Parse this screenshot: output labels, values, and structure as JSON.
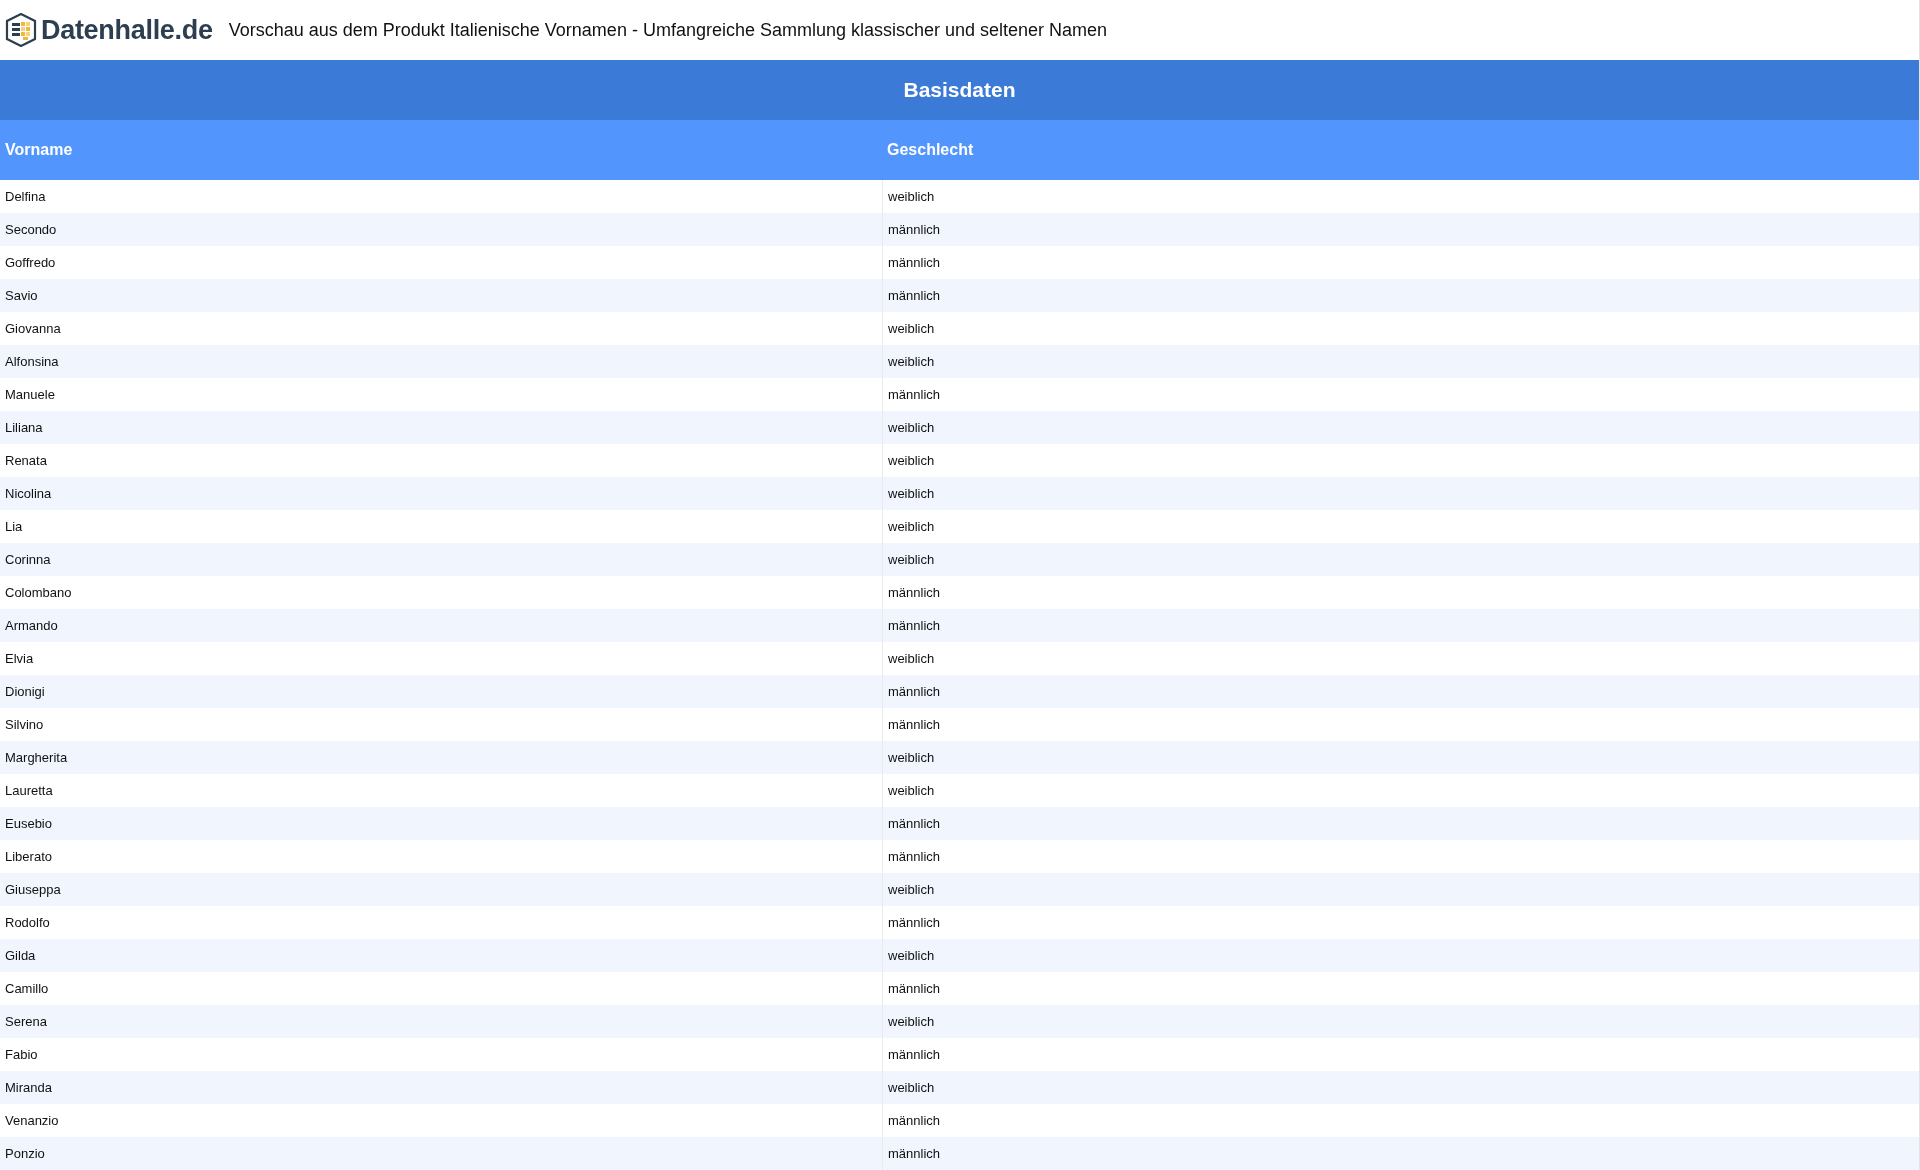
{
  "header": {
    "logo_text": "Datenhalle.de",
    "title": "Vorschau aus dem Produkt Italienische Vornamen - Umfangreiche Sammlung klassischer und seltener Namen"
  },
  "table": {
    "group_heading": "Basisdaten",
    "columns": [
      "Vorname",
      "Geschlecht"
    ],
    "rows": [
      [
        "Delfina",
        "weiblich"
      ],
      [
        "Secondo",
        "männlich"
      ],
      [
        "Goffredo",
        "männlich"
      ],
      [
        "Savio",
        "männlich"
      ],
      [
        "Giovanna",
        "weiblich"
      ],
      [
        "Alfonsina",
        "weiblich"
      ],
      [
        "Manuele",
        "männlich"
      ],
      [
        "Liliana",
        "weiblich"
      ],
      [
        "Renata",
        "weiblich"
      ],
      [
        "Nicolina",
        "weiblich"
      ],
      [
        "Lia",
        "weiblich"
      ],
      [
        "Corinna",
        "weiblich"
      ],
      [
        "Colombano",
        "männlich"
      ],
      [
        "Armando",
        "männlich"
      ],
      [
        "Elvia",
        "weiblich"
      ],
      [
        "Dionigi",
        "männlich"
      ],
      [
        "Silvino",
        "männlich"
      ],
      [
        "Margherita",
        "weiblich"
      ],
      [
        "Lauretta",
        "weiblich"
      ],
      [
        "Eusebio",
        "männlich"
      ],
      [
        "Liberato",
        "männlich"
      ],
      [
        "Giuseppa",
        "weiblich"
      ],
      [
        "Rodolfo",
        "männlich"
      ],
      [
        "Gilda",
        "weiblich"
      ],
      [
        "Camillo",
        "männlich"
      ],
      [
        "Serena",
        "weiblich"
      ],
      [
        "Fabio",
        "männlich"
      ],
      [
        "Miranda",
        "weiblich"
      ],
      [
        "Venanzio",
        "männlich"
      ],
      [
        "Ponzio",
        "männlich"
      ]
    ]
  }
}
